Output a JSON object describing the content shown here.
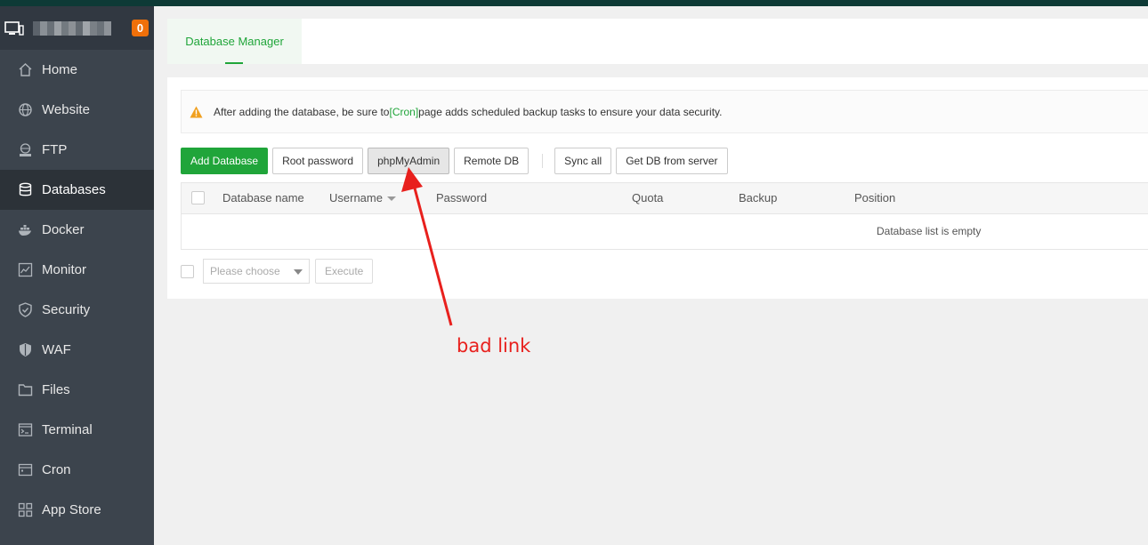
{
  "sidebar": {
    "badge": "0",
    "username_pixels": [
      "#5c636b",
      "#8a9096",
      "#6a7178",
      "#9ba0a5",
      "#737a80",
      "#8c9196",
      "#646b72",
      "#a0a5aa",
      "#7a8086",
      "#6b7279",
      "#8e9399"
    ],
    "items": [
      {
        "label": "Home",
        "icon": "home-icon"
      },
      {
        "label": "Website",
        "icon": "globe-icon"
      },
      {
        "label": "FTP",
        "icon": "ftp-icon"
      },
      {
        "label": "Databases",
        "icon": "database-icon",
        "active": true
      },
      {
        "label": "Docker",
        "icon": "docker-icon"
      },
      {
        "label": "Monitor",
        "icon": "monitor-icon"
      },
      {
        "label": "Security",
        "icon": "shield-icon"
      },
      {
        "label": "WAF",
        "icon": "waf-icon"
      },
      {
        "label": "Files",
        "icon": "folder-icon"
      },
      {
        "label": "Terminal",
        "icon": "terminal-icon"
      },
      {
        "label": "Cron",
        "icon": "cron-icon"
      },
      {
        "label": "App Store",
        "icon": "grid-icon"
      }
    ]
  },
  "tabs": {
    "database_manager": "Database Manager"
  },
  "alert": {
    "before": "After adding the database, be sure to ",
    "link": "[Cron]",
    "after": " page adds scheduled backup tasks to ensure your data security."
  },
  "toolbar": {
    "add_database": "Add Database",
    "root_password": "Root password",
    "phpmyadmin": "phpMyAdmin",
    "remote_db": "Remote DB",
    "sync_all": "Sync all",
    "get_db_from_server": "Get DB from server"
  },
  "table": {
    "columns": {
      "database_name": "Database name",
      "username": "Username",
      "password": "Password",
      "quota": "Quota",
      "backup": "Backup",
      "position": "Position"
    },
    "empty": "Database list is empty"
  },
  "footer": {
    "select_placeholder": "Please choose",
    "execute": "Execute"
  },
  "annotation": {
    "text": "bad link",
    "color": "#e8201d"
  },
  "colors": {
    "accent": "#20a53a",
    "sidebar": "#3c444d",
    "badge": "#f0700a"
  }
}
